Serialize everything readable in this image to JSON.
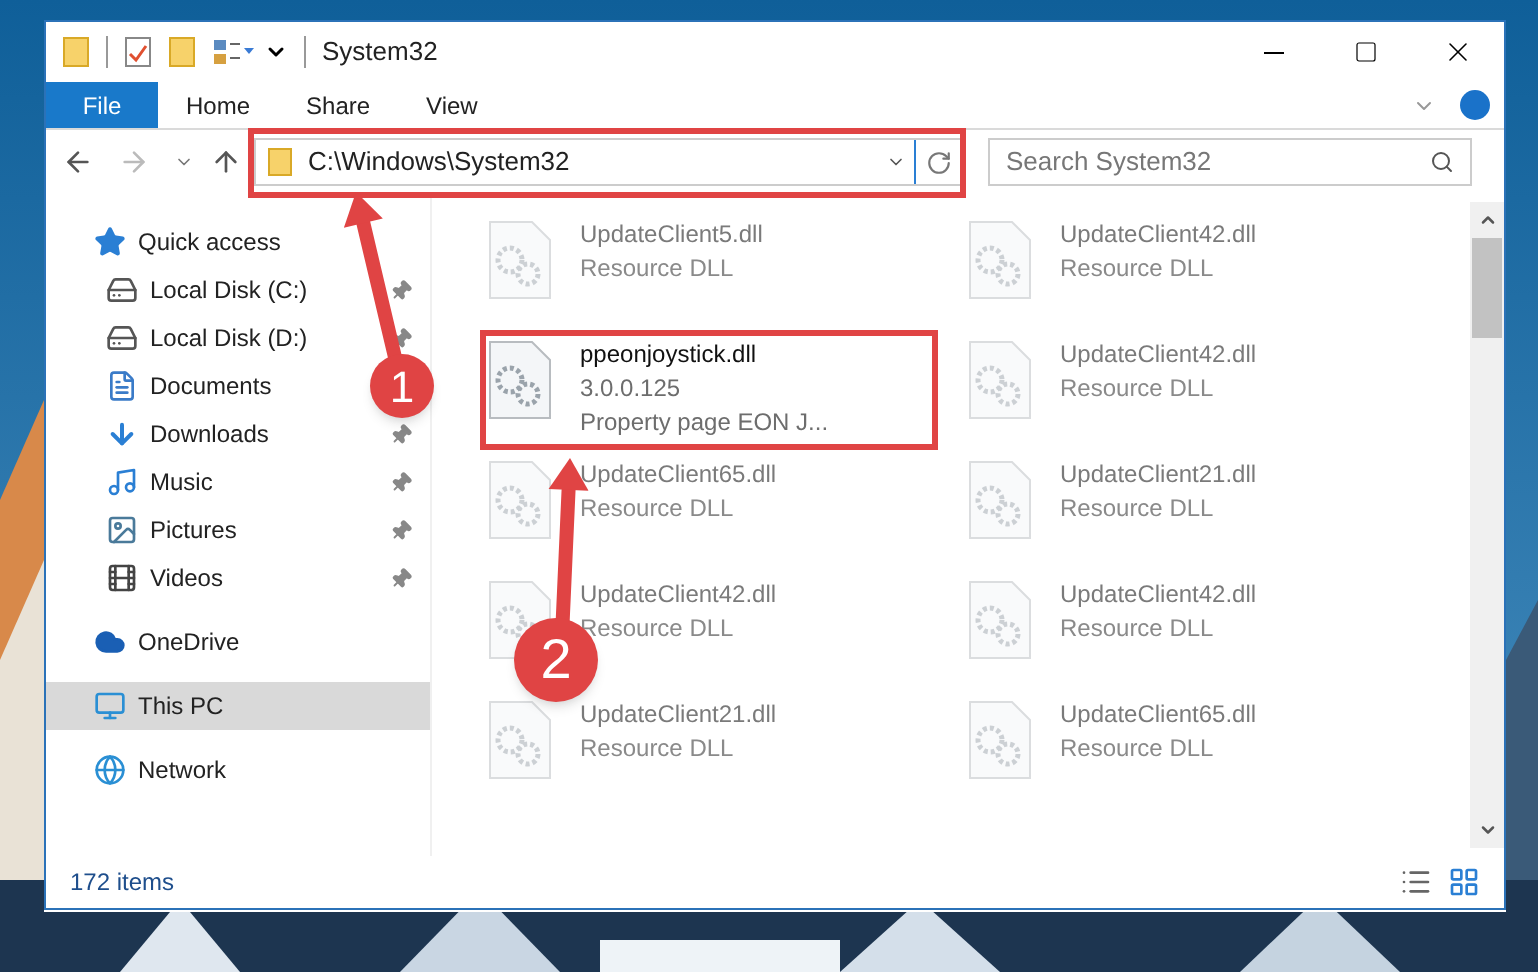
{
  "window": {
    "title": "System32"
  },
  "ribbon": {
    "tabs": [
      {
        "label": "File",
        "selected": true
      },
      {
        "label": "Home",
        "selected": false
      },
      {
        "label": "Share",
        "selected": false
      },
      {
        "label": "View",
        "selected": false
      }
    ]
  },
  "address": {
    "path": "C:\\Windows\\System32"
  },
  "search": {
    "placeholder": "Search System32"
  },
  "sidebar": {
    "items": [
      {
        "label": "Quick access",
        "kind": "star",
        "selected": false,
        "children": [
          {
            "label": "Local Disk (C:)",
            "kind": "system-drive",
            "pinned": true
          },
          {
            "label": "Local Disk (D:)",
            "kind": "drive",
            "pinned": true
          },
          {
            "label": "Documents",
            "kind": "documents",
            "pinned": false
          },
          {
            "label": "Downloads",
            "kind": "downloads",
            "pinned": true
          },
          {
            "label": "Music",
            "kind": "music",
            "pinned": true
          },
          {
            "label": "Pictures",
            "kind": "pictures",
            "pinned": true
          },
          {
            "label": "Videos",
            "kind": "videos",
            "pinned": true
          }
        ]
      },
      {
        "label": "OneDrive",
        "kind": "cloud",
        "selected": false
      },
      {
        "label": "This PC",
        "kind": "pc",
        "selected": true
      },
      {
        "label": "Network",
        "kind": "network",
        "selected": false
      }
    ]
  },
  "files": [
    {
      "name": "UpdateClient5.dll",
      "details": [
        "Resource DLL"
      ],
      "dimmed": true
    },
    {
      "name": "UpdateClient42.dll",
      "details": [
        "Resource DLL"
      ],
      "dimmed": true
    },
    {
      "name": "ppeonjoystick.dll",
      "details": [
        "3.0.0.125",
        "Property page EON J..."
      ],
      "dimmed": false
    },
    {
      "name": "UpdateClient42.dll",
      "details": [
        "Resource DLL"
      ],
      "dimmed": true
    },
    {
      "name": "UpdateClient65.dll",
      "details": [
        "Resource DLL"
      ],
      "dimmed": true
    },
    {
      "name": "UpdateClient21.dll",
      "details": [
        "Resource DLL"
      ],
      "dimmed": true
    },
    {
      "name": "UpdateClient42.dll",
      "details": [
        "Resource DLL"
      ],
      "dimmed": true
    },
    {
      "name": "UpdateClient42.dll",
      "details": [
        "Resource DLL"
      ],
      "dimmed": true
    },
    {
      "name": "UpdateClient21.dll",
      "details": [
        "Resource DLL"
      ],
      "dimmed": true
    },
    {
      "name": "UpdateClient65.dll",
      "details": [
        "Resource DLL"
      ],
      "dimmed": true
    }
  ],
  "status_bar": {
    "item_count": "172 items"
  },
  "annotations": [
    {
      "label": "1"
    },
    {
      "label": "2"
    }
  ]
}
